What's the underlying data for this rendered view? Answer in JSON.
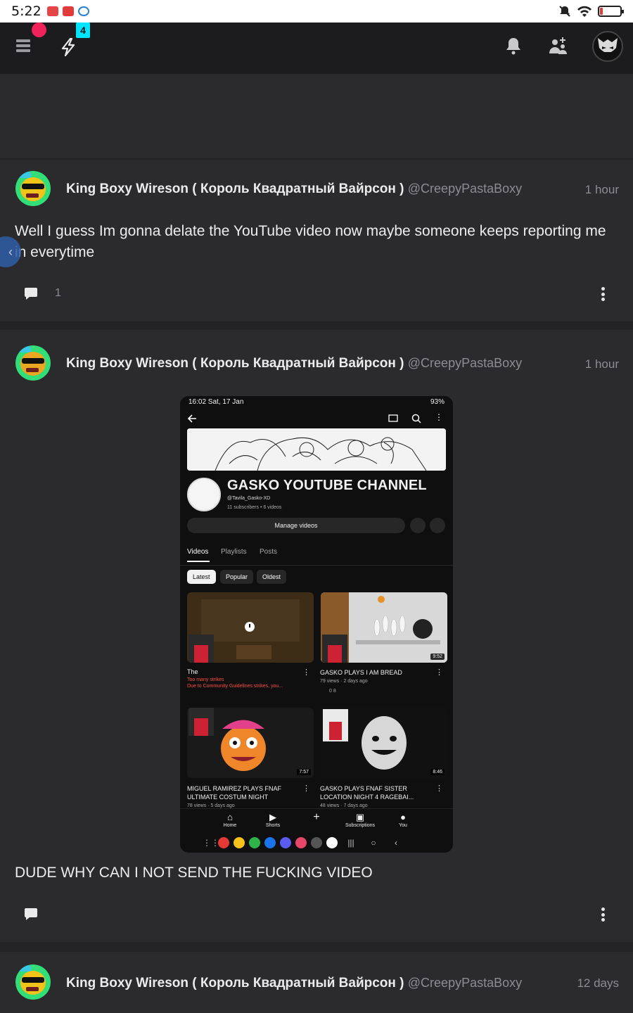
{
  "status_bar": {
    "time": "5:22"
  },
  "app_bar": {
    "notification_badge": "4"
  },
  "posts": [
    {
      "author": "King Boxy Wireson ( Король Квадратный Вайрсон )",
      "handle": "@CreepyPastaBoxy",
      "time": "1 hour",
      "text": "Well I guess Im gonna delate the YouTube video now maybe someone keeps reporting me in everytime",
      "comment_count": "1"
    },
    {
      "author": "King Boxy Wireson ( Король Квадратный Вайрсон )",
      "handle": "@CreepyPastaBoxy",
      "time": "1 hour",
      "text": "DUDE WHY CAN I NOT SEND THE FUCKING VIDEO",
      "comment_count": ""
    },
    {
      "author": "King Boxy Wireson ( Король Квадратный Вайрсон )",
      "handle": "@CreepyPastaBoxy",
      "time": "12 days"
    }
  ],
  "embedded_screenshot": {
    "status_time": "16:02  Sat, 17 Jan",
    "status_right": "93%",
    "channel_name": "GASKO YOUTUBE CHANNEL",
    "channel_handle": "@Tavila_Gasko-XD",
    "channel_stats": "11 subscribers • 6 videos",
    "manage_videos": "Manage videos",
    "tabs": [
      "Videos",
      "Playlists",
      "Posts"
    ],
    "chips": [
      "Latest",
      "Popular",
      "Oldest"
    ],
    "videos": [
      {
        "title": "The",
        "meta1": "Too many strikes",
        "meta2": "Due to Community Guidelines strikes, you...",
        "duration": ""
      },
      {
        "title": "GASKO PLAYS I AM BREAD",
        "meta1": "79 views · 2 days ago",
        "meta2": "0   8",
        "duration": "9:52"
      },
      {
        "title": "MIGUEL RAMIREZ PLAYS FNAF ULTIMATE COSTUM NIGHT",
        "meta1": "78 views · 5 days ago",
        "duration": "7:57"
      },
      {
        "title": "GASKO PLAYS FNAF SISTER LOCATION NIGHT 4 RAGEBAI...",
        "meta1": "48 views · 7 days ago",
        "duration": "8:46"
      }
    ],
    "bottom_nav": [
      "Home",
      "Shorts",
      "",
      "Subscriptions",
      "You"
    ]
  },
  "colors": {
    "accent_badge": "#00e5ff",
    "notification_dot": "#f0245a",
    "background": "#2b2a2d",
    "bar": "#1c1c1e"
  }
}
